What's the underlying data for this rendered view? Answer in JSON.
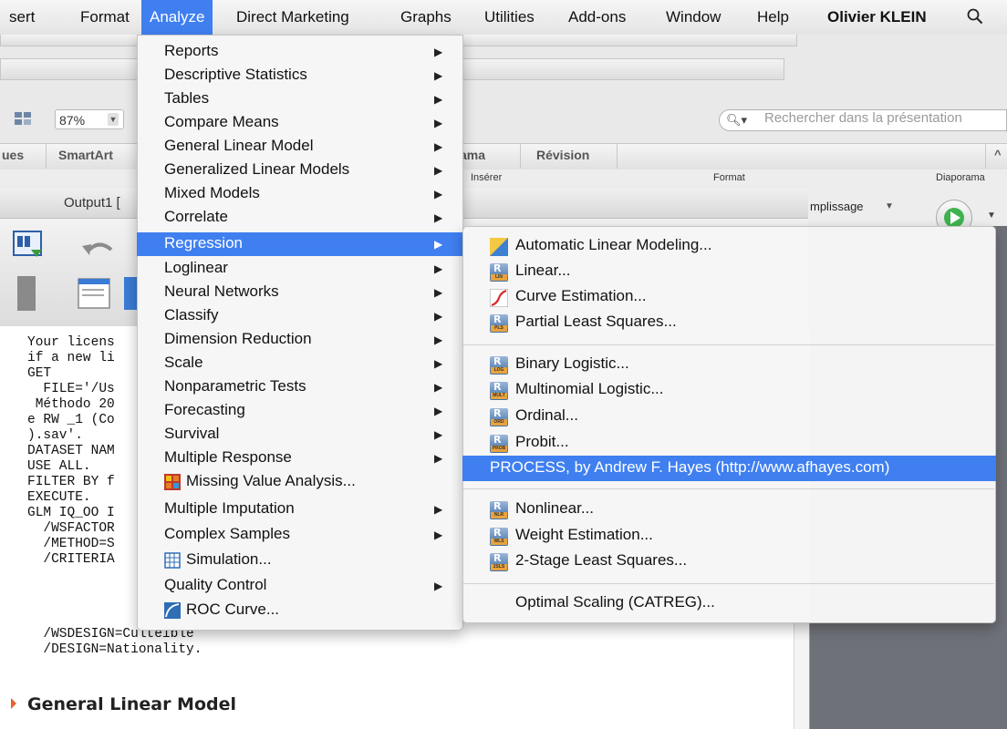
{
  "menubar": {
    "items": [
      "sert",
      "Format",
      "Analyze",
      "Direct Marketing",
      "Graphs",
      "Utilities",
      "Add-ons",
      "Window",
      "Help"
    ],
    "user": "Olivier KLEIN"
  },
  "ppt": {
    "zoom": "87%",
    "search_placeholder": "Rechercher dans la présentation",
    "ribbon_tabs": [
      "ues",
      "SmartArt",
      "ama",
      "Révision"
    ],
    "group_labels": [
      "Insérer",
      "Format",
      "Diaporama"
    ],
    "fill_label": "mplissage"
  },
  "output_window": {
    "title": "Output1 [",
    "code_lines": [
      "Your licens",
      "if a new li",
      "GET",
      "  FILE='/Us",
      " Méthodo 20",
      "e RW _1 (Co",
      ").sav'.",
      "DATASET NAM",
      "USE ALL.",
      "FILTER BY f",
      "EXECUTE.",
      "GLM IQ_OO I",
      "  /WSFACTOR",
      "  /METHOD=S",
      "  /CRITERIA",
      "  /WSDESIGN=Culteible",
      "  /DESIGN=Nationality."
    ],
    "heading": "General Linear Model"
  },
  "analyze_menu": {
    "items": [
      {
        "label": "Reports",
        "submenu": true
      },
      {
        "label": "Descriptive Statistics",
        "submenu": true
      },
      {
        "label": "Tables",
        "submenu": true
      },
      {
        "label": "Compare Means",
        "submenu": true
      },
      {
        "label": "General Linear Model",
        "submenu": true
      },
      {
        "label": "Generalized Linear Models",
        "submenu": true
      },
      {
        "label": "Mixed Models",
        "submenu": true
      },
      {
        "label": "Correlate",
        "submenu": true
      },
      {
        "label": "Regression",
        "submenu": true,
        "selected": true
      },
      {
        "label": "Loglinear",
        "submenu": true
      },
      {
        "label": "Neural Networks",
        "submenu": true
      },
      {
        "label": "Classify",
        "submenu": true
      },
      {
        "label": "Dimension Reduction",
        "submenu": true
      },
      {
        "label": "Scale",
        "submenu": true
      },
      {
        "label": "Nonparametric Tests",
        "submenu": true
      },
      {
        "label": "Forecasting",
        "submenu": true
      },
      {
        "label": "Survival",
        "submenu": true
      },
      {
        "label": "Multiple Response",
        "submenu": true
      },
      {
        "label": "Missing Value Analysis...",
        "icon": "missing-value-icon"
      },
      {
        "label": "Multiple Imputation",
        "submenu": true
      },
      {
        "label": "Complex Samples",
        "submenu": true
      },
      {
        "label": "Simulation...",
        "icon": "simulation-icon"
      },
      {
        "label": "Quality Control",
        "submenu": true
      },
      {
        "label": "ROC Curve...",
        "icon": "roc-curve-icon"
      }
    ]
  },
  "regression_menu": {
    "items": [
      {
        "label": "Automatic Linear Modeling...",
        "icon": "automatic-linear-modeling-icon"
      },
      {
        "label": "Linear...",
        "icon": "linear-regression-icon",
        "badge": "LIN"
      },
      {
        "label": "Curve Estimation...",
        "icon": "curve-estimation-icon"
      },
      {
        "label": "Partial Least Squares...",
        "icon": "partial-least-squares-icon",
        "badge": "PLS"
      },
      {
        "label": "Binary Logistic...",
        "icon": "binary-logistic-icon",
        "badge": "LOG"
      },
      {
        "label": "Multinomial Logistic...",
        "icon": "multinomial-logistic-icon",
        "badge": "MULT"
      },
      {
        "label": "Ordinal...",
        "icon": "ordinal-icon",
        "badge": "ORD"
      },
      {
        "label": "Probit...",
        "icon": "probit-icon",
        "badge": "PROB"
      },
      {
        "label": "PROCESS, by Andrew F. Hayes (http://www.afhayes.com)",
        "selected": true
      },
      {
        "label": "Nonlinear...",
        "icon": "nonlinear-icon",
        "badge": "NLR"
      },
      {
        "label": "Weight Estimation...",
        "icon": "weight-estimation-icon",
        "badge": "WLS"
      },
      {
        "label": "2-Stage Least Squares...",
        "icon": "two-stage-least-squares-icon",
        "badge": "2SLS"
      },
      {
        "label": "Optimal Scaling (CATREG)..."
      }
    ]
  },
  "colors": {
    "selection": "#3f7ff0",
    "menu_bg": "#f6f6f6",
    "heading_marker": "#e3632d"
  }
}
